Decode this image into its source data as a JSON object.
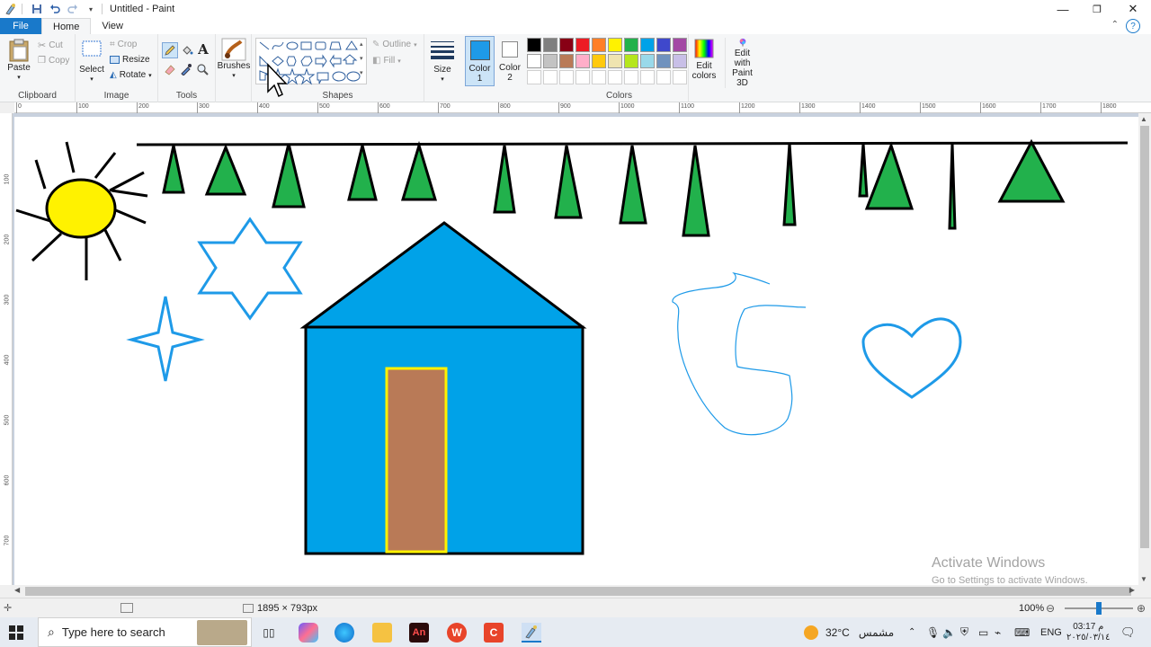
{
  "window": {
    "title": "Untitled - Paint",
    "minimize": "—",
    "maximize": "❐",
    "close": "✕"
  },
  "tabs": [
    {
      "label": "File"
    },
    {
      "label": "Home"
    },
    {
      "label": "View"
    }
  ],
  "help": "?",
  "ribbon": {
    "clipboard": {
      "label": "Clipboard",
      "paste": "Paste",
      "cut": "Cut",
      "copy": "Copy"
    },
    "image": {
      "label": "Image",
      "select": "Select",
      "crop": "Crop",
      "resize": "Resize",
      "rotate": "Rotate"
    },
    "tools": {
      "label": "Tools"
    },
    "brushes": {
      "label": "Brushes"
    },
    "shapes": {
      "label": "Shapes",
      "outline": "Outline",
      "fill": "Fill"
    },
    "size": {
      "label": "Size"
    },
    "color1": {
      "label": "Color 1",
      "value": "#1e9ae8"
    },
    "color2": {
      "label": "Color 2",
      "value": "#ffffff"
    },
    "colors": {
      "label": "Colors",
      "row1": [
        "#000000",
        "#7f7f7f",
        "#880015",
        "#ed1c24",
        "#ff7f27",
        "#fff200",
        "#22b14c",
        "#00a2e8",
        "#3f48cc",
        "#a349a4"
      ],
      "row2": [
        "#ffffff",
        "#c3c3c3",
        "#b97a57",
        "#ffaec9",
        "#ffc90e",
        "#efe4b0",
        "#b5e61d",
        "#99d9ea",
        "#7092be",
        "#c8bfe7"
      ]
    },
    "edit_colors": "Edit colors",
    "edit_paint3d": "Edit with Paint 3D"
  },
  "ruler": {
    "h_labels": [
      "0",
      "100",
      "200",
      "300",
      "400",
      "500",
      "600",
      "700",
      "800",
      "900",
      "1000",
      "1100",
      "1200",
      "1300",
      "1400",
      "1500",
      "1600",
      "1700",
      "1800"
    ],
    "v_labels": [
      "100",
      "200",
      "300",
      "400",
      "500",
      "600",
      "700"
    ]
  },
  "drawing": {
    "sun_color": "#fff200",
    "tree_color": "#22b14c",
    "house_color": "#00a2e8",
    "door_color": "#b97a57",
    "door_border": "#fff200",
    "outline_color": "#1e9ae8"
  },
  "status": {
    "canvas_size": "1895 × 793px",
    "zoom": "100%"
  },
  "watermark": {
    "line1": "Activate Windows",
    "line2": "Go to Settings to activate Windows."
  },
  "taskbar": {
    "search_placeholder": "Type here to search",
    "temperature": "32°C",
    "weather": "مشمس",
    "language": "ENG",
    "time": "03:17 م",
    "date": "٢٠٢٥/٠٣/١٤"
  }
}
